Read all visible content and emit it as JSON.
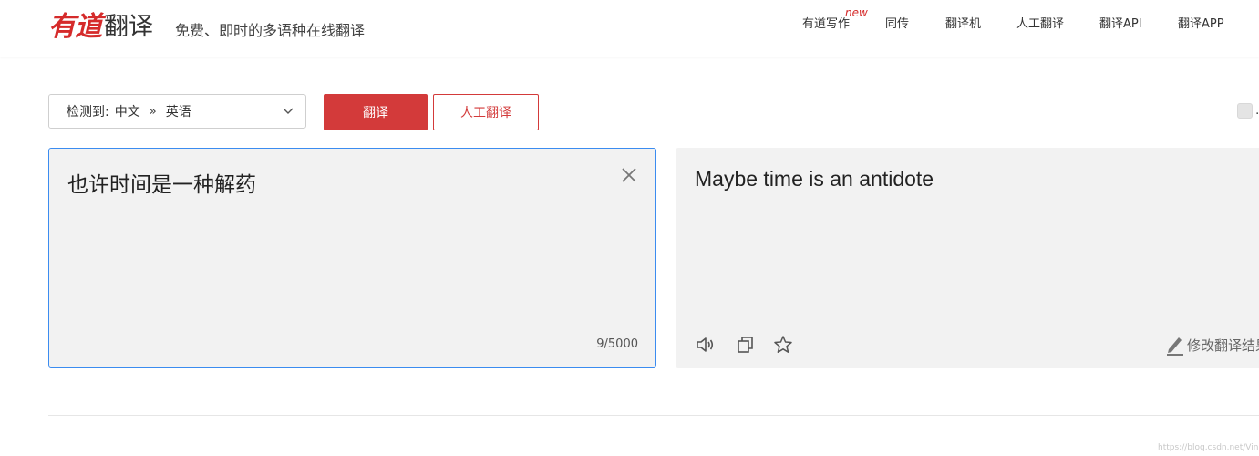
{
  "header": {
    "brand": "有道",
    "product": "翻译",
    "slogan": "免费、即时的多语种在线翻译",
    "nav": [
      {
        "label": "有道写作",
        "badge": "new"
      },
      {
        "label": "同传"
      },
      {
        "label": "翻译机"
      },
      {
        "label": "人工翻译"
      },
      {
        "label": "翻译API"
      },
      {
        "label": "翻译APP"
      }
    ]
  },
  "toolbar": {
    "lang_detect_label": "检测到:",
    "source_lang": "中文",
    "arrow": "»",
    "target_lang": "英语",
    "translate_label": "翻译",
    "human_translate_label": "人工翻译",
    "checkbox_label": "…"
  },
  "input": {
    "text": "也许时间是一种解药",
    "char_count": "9/5000"
  },
  "output": {
    "text": "Maybe time is an antidote",
    "edit_label": "修改翻译结果"
  },
  "icons": {
    "speaker": "speaker-icon",
    "copy": "copy-icon",
    "star": "star-icon",
    "pencil": "pencil-icon",
    "close": "close-icon",
    "chevron": "chevron-down-icon"
  },
  "colors": {
    "brand_red": "#d33a3a",
    "focus_blue": "#3b8cf0",
    "panel_bg": "#f2f2f2"
  },
  "footer": {
    "watermark": "https://blog.csdn.net/Vinking"
  }
}
